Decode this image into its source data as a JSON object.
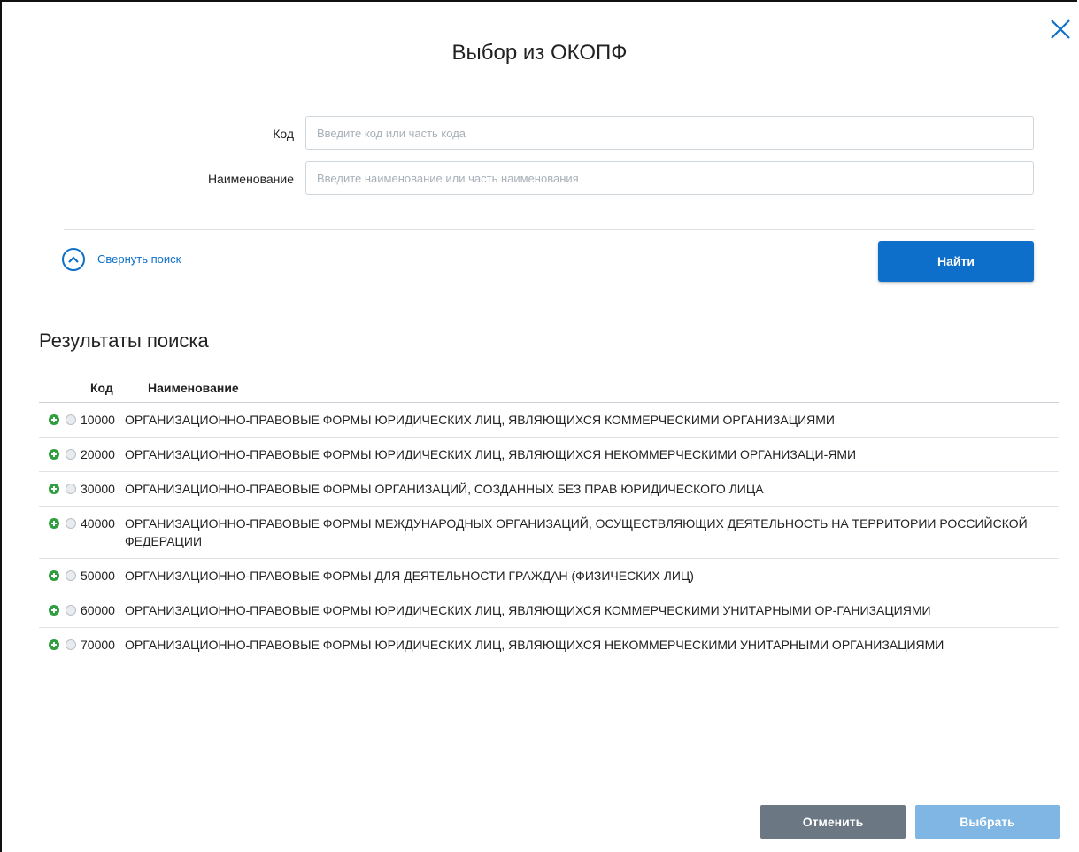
{
  "dialog": {
    "title": "Выбор из ОКОПФ"
  },
  "form": {
    "code_label": "Код",
    "code_placeholder": "Введите код или часть кода",
    "code_value": "",
    "name_label": "Наименование",
    "name_placeholder": "Введите наименование или часть наименования",
    "name_value": ""
  },
  "search": {
    "collapse_label": "Свернуть поиск",
    "find_label": "Найти"
  },
  "results": {
    "title": "Результаты поиска",
    "columns": {
      "code": "Код",
      "name": "Наименование"
    },
    "rows": [
      {
        "code": "10000",
        "name": "ОРГАНИЗАЦИОННО-ПРАВОВЫЕ ФОРМЫ ЮРИДИЧЕСКИХ ЛИЦ, ЯВЛЯЮЩИХСЯ КОММЕРЧЕСКИМИ ОРГАНИЗАЦИЯМИ"
      },
      {
        "code": "20000",
        "name": "ОРГАНИЗАЦИОННО-ПРАВОВЫЕ ФОРМЫ ЮРИДИЧЕСКИХ ЛИЦ, ЯВЛЯЮЩИХСЯ НЕКОММЕРЧЕСКИМИ ОРГАНИЗАЦИ-ЯМИ"
      },
      {
        "code": "30000",
        "name": "ОРГАНИЗАЦИОННО-ПРАВОВЫЕ ФОРМЫ ОРГАНИЗАЦИЙ, СОЗДАННЫХ БЕЗ ПРАВ ЮРИДИЧЕСКОГО ЛИЦА"
      },
      {
        "code": "40000",
        "name": "ОРГАНИЗАЦИОННО-ПРАВОВЫЕ ФОРМЫ МЕЖДУНАРОДНЫХ ОРГАНИЗАЦИЙ, ОСУЩЕСТВЛЯЮЩИХ ДЕЯТЕЛЬНОСТЬ НА ТЕРРИТОРИИ РОССИЙСКОЙ ФЕДЕРАЦИИ"
      },
      {
        "code": "50000",
        "name": "ОРГАНИЗАЦИОННО-ПРАВОВЫЕ ФОРМЫ ДЛЯ ДЕЯТЕЛЬНОСТИ ГРАЖДАН (ФИЗИЧЕСКИХ ЛИЦ)"
      },
      {
        "code": "60000",
        "name": "ОРГАНИЗАЦИОННО-ПРАВОВЫЕ ФОРМЫ ЮРИДИЧЕСКИХ ЛИЦ, ЯВЛЯЮЩИХСЯ КОММЕРЧЕСКИМИ УНИТАРНЫМИ ОР-ГАНИЗАЦИЯМИ"
      },
      {
        "code": "70000",
        "name": "ОРГАНИЗАЦИОННО-ПРАВОВЫЕ ФОРМЫ ЮРИДИЧЕСКИХ ЛИЦ, ЯВЛЯЮЩИХСЯ НЕКОММЕРЧЕСКИМИ УНИТАРНЫМИ ОРГАНИЗАЦИЯМИ"
      }
    ]
  },
  "footer": {
    "cancel_label": "Отменить",
    "select_label": "Выбрать"
  },
  "colors": {
    "primary": "#0d6fc9",
    "expand_green": "#2e9e3e",
    "cancel_gray": "#6b7884",
    "select_disabled": "#7fb6e4"
  },
  "icons": {
    "close": "close-icon",
    "collapse": "chevron-up-circle-icon",
    "expand_row": "plus-circle-icon",
    "select_row": "radio-icon"
  }
}
